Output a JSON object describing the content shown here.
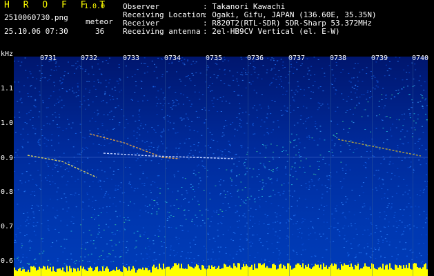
{
  "header": {
    "app_name": "H R O F F T",
    "version": "1.0.0",
    "file_name": "2510060730.png",
    "datetime": "25.10.06 07:30",
    "meteor_label": "meteor",
    "meteor_count": "36",
    "rows": [
      {
        "label": "Observer",
        "value": ": Takanori Kawachi"
      },
      {
        "label": "Receiving Location",
        "value": ": Ogaki, Gifu, JAPAN (136.60E, 35.35N)"
      },
      {
        "label": "Receiver",
        "value": ": R820T2(RTL-SDR) SDR-Sharp 53.372MHz"
      },
      {
        "label": "Receiving antenna",
        "value": ": 2el-HB9CV Vertical (el. E-W)"
      }
    ]
  },
  "axis": {
    "y_unit": "kHz",
    "x_ticks": [
      "0731",
      "0732",
      "0733",
      "0734",
      "0735",
      "0736",
      "0737",
      "0738",
      "0739",
      "0740"
    ],
    "y_ticks": [
      "1.1",
      "1.0",
      "0.9",
      "0.8",
      "0.7",
      "0.6"
    ]
  },
  "colors": {
    "background": "#000000",
    "header_accent": "#ffff00",
    "spectrum_base": "#0033aa",
    "noise_floor": "#ffff00"
  },
  "chart_data": {
    "type": "heatmap",
    "x_ticks": [
      "0731",
      "0732",
      "0733",
      "0734",
      "0735",
      "0736",
      "0737",
      "0738",
      "0739",
      "0740"
    ],
    "y_unit": "kHz",
    "y_ticks": [
      1.1,
      1.0,
      0.9,
      0.8,
      0.7,
      0.6
    ],
    "meteor_count": 36
  }
}
